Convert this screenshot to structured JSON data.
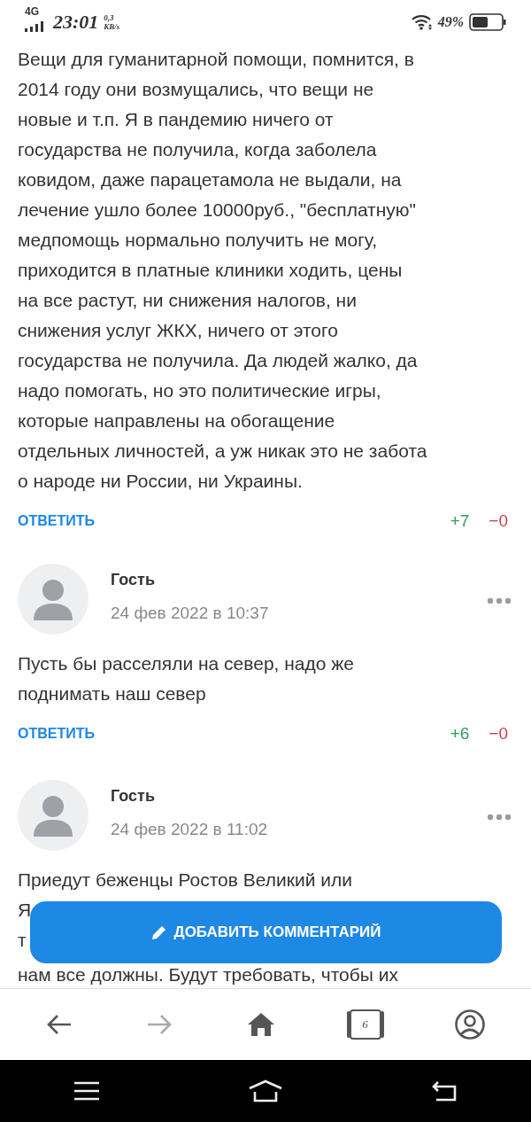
{
  "status_bar": {
    "network": "4G",
    "time": "23:01",
    "speed_value": "0,3",
    "speed_unit": "KB/s",
    "battery": "49%"
  },
  "first_comment": {
    "lines": [
      "Вещи для гуманитарной помощи, помнится, в",
      "2014 году они возмущались, что вещи не",
      "новые и т.п. Я в пандемию ничего от",
      "государства не получила, когда заболела",
      "ковидом, даже парацетамола не выдали, на",
      "лечение ушло более 10000руб., \"бесплатную\"",
      "медпомощь нормально получить не могу,",
      "приходится в платные клиники ходить, цены",
      "на все растут, ни снижения налогов, ни",
      "снижения услуг ЖКХ, ничего от этого",
      "государства не получила. Да людей жалко, да",
      "надо помогать, но это политические игры,",
      "которые направлены на обогащение",
      "отдельных личностей, а уж никак это не забота",
      "о народе ни России, ни Украины."
    ],
    "reply": "ОТВЕТИТЬ",
    "likes": "+7",
    "dislikes": "−0"
  },
  "comments": [
    {
      "author": "Гость",
      "date": "24 фев 2022 в 10:37",
      "lines": [
        "Пусть бы расселяли на север, надо же",
        "поднимать наш север"
      ],
      "reply": "ОТВЕТИТЬ",
      "likes": "+6",
      "dislikes": "−0"
    },
    {
      "author": "Гость",
      "date": "24 фев 2022 в 11:02",
      "lines": [
        "Приедут беженцы Ростов Великий или",
        "Я",
        "т",
        "нам все должны. Будут требовать, чтобы их"
      ]
    }
  ],
  "add_comment_button": "ДОБАВИТЬ КОММЕНТАРИЙ",
  "browser_nav": [
    {
      "kind": "back",
      "disabled": false
    },
    {
      "kind": "forward",
      "disabled": true
    },
    {
      "kind": "home",
      "disabled": false
    },
    {
      "kind": "tabs",
      "count": "6",
      "disabled": false
    },
    {
      "kind": "profile",
      "disabled": false
    }
  ]
}
